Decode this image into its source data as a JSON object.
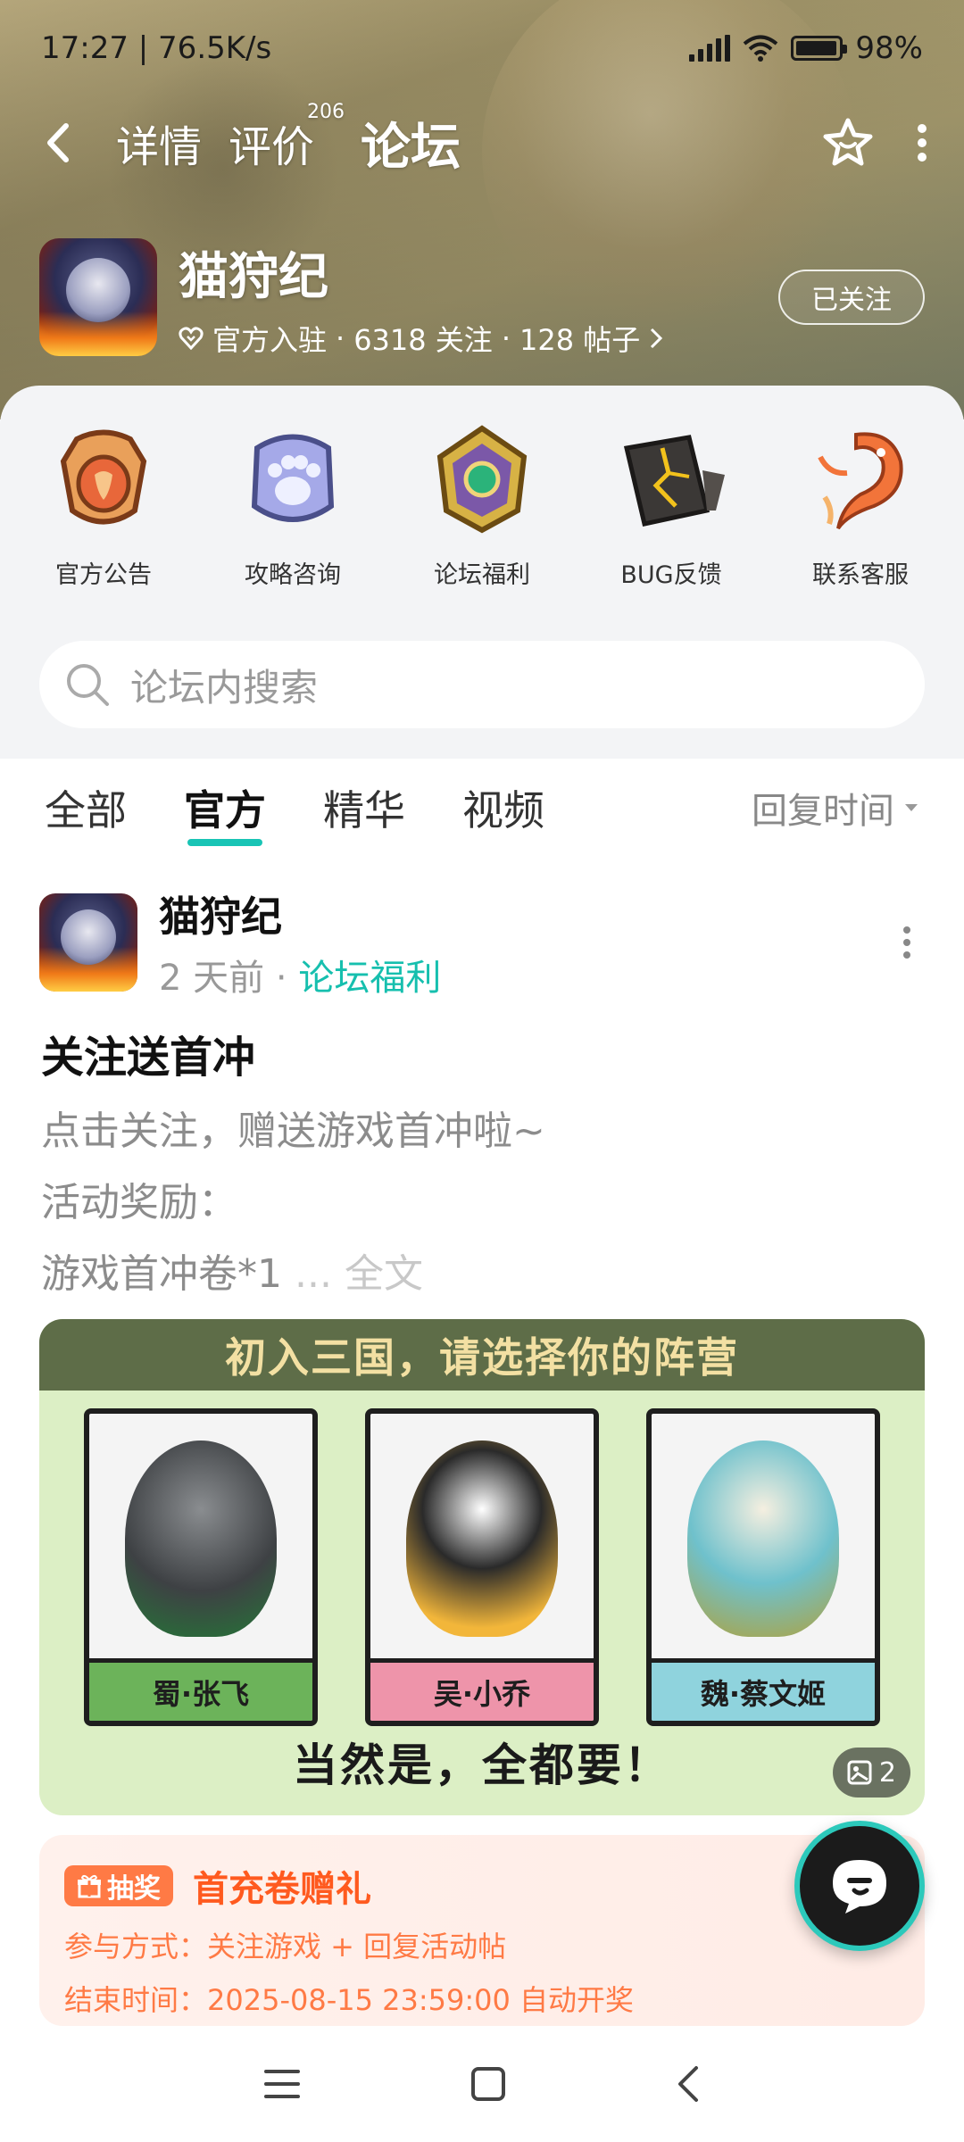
{
  "status_bar": {
    "time_speed": "17:27 | 76.5K/s",
    "battery": "98%",
    "battery_level": 0.98
  },
  "nav": {
    "tabs": [
      {
        "label": "详情"
      },
      {
        "label": "评价",
        "badge": "206"
      },
      {
        "label": "论坛"
      }
    ],
    "active_tab": "论坛"
  },
  "game": {
    "title": "猫狩纪",
    "official": "官方入驻",
    "followers": "6318 关注",
    "posts": "128 帖子",
    "follow_button": "已关注"
  },
  "categories": [
    {
      "label": "官方公告",
      "icon": "shield-badge-icon"
    },
    {
      "label": "攻略咨询",
      "icon": "paw-badge-icon"
    },
    {
      "label": "论坛福利",
      "icon": "gem-badge-icon"
    },
    {
      "label": "BUG反馈",
      "icon": "cracked-stone-icon"
    },
    {
      "label": "联系客服",
      "icon": "koi-fish-icon"
    }
  ],
  "search": {
    "placeholder": "论坛内搜索"
  },
  "filters": {
    "tabs": [
      "全部",
      "官方",
      "精华",
      "视频"
    ],
    "active": "官方",
    "sort": "回复时间"
  },
  "post": {
    "author": "猫狩纪",
    "time": "2 天前",
    "tag": "论坛福利",
    "title": "关注送首冲",
    "body_lines": [
      "点击关注，赠送游戏首冲啦~",
      "活动奖励：",
      "游戏首冲卷*1"
    ],
    "ellipsis": "...",
    "full_text": "全文",
    "banner": {
      "heading": "初入三国，请选择你的阵营",
      "cards": [
        "蜀·张飞",
        "吴·小乔",
        "魏·蔡文姬"
      ],
      "slogan": "当然是，全都要！",
      "image_count": "2"
    }
  },
  "lottery": {
    "badge": "抽奖",
    "title": "首充卷赠礼",
    "participation": "参与方式：关注游戏 + 回复活动帖",
    "end_time": "结束时间：2025-08-15 23:59:00 自动开奖"
  },
  "colors": {
    "accent": "#19c4b5",
    "lottery": "#ff7a45"
  }
}
